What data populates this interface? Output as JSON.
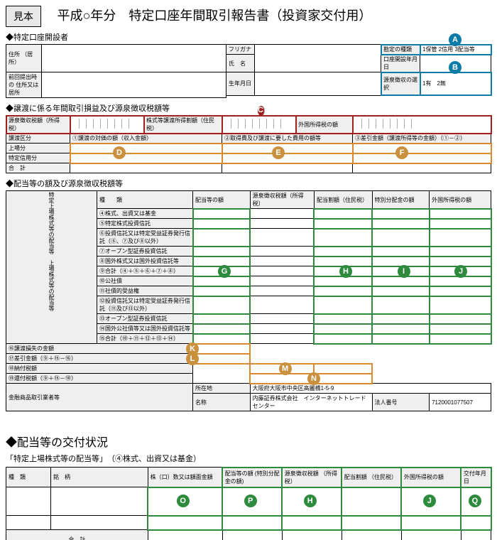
{
  "header": {
    "mihon": "見本",
    "title": "平成○年分　特定口座年間取引報告書（投資家交付用）"
  },
  "section1": {
    "label": "◆特定口座開設者",
    "address_label": "住所\n（居所）",
    "prev_address_label": "前回提出時の\n住所又は居所",
    "furigana": "フリガナ",
    "name_label": "氏　名",
    "birth_label": "生年月日",
    "account_type_label": "勘定の種類",
    "account_type_value": "1保管 2信用 3配当等",
    "open_date_label": "口座開設年月日",
    "withholding_label": "源泉徴収の選択",
    "withholding_value": "1有　2無"
  },
  "section2": {
    "label": "◆譲渡に係る年間取引損益及び源泉徴収税額等",
    "col1": "源泉徴収税額（所得税）",
    "col2": "株式等譲渡所得割額（住民税）",
    "col3": "外国所得税の額",
    "row_label": "譲渡区分",
    "sub1": "①譲渡の対価の額（収入金額）",
    "sub2": "②取得費及び譲渡に要した費用の額等",
    "sub3": "③差引金額（譲渡所得等の金額）（①－②）",
    "row1": "上場分",
    "row2": "特定信用分",
    "row3": "合　計"
  },
  "section3": {
    "label": "◆配当等の額及び源泉徴収税額等",
    "hdr_kind": "種　　類",
    "hdr_c1": "配当等の額",
    "hdr_c2": "源泉徴収税額（所得税）",
    "hdr_c3": "配当割額（住民税）",
    "hdr_c4": "特別分配金の額",
    "hdr_c5": "外国所得税の額",
    "rows": [
      "④株式、出資又は基金",
      "⑤特定株式投資信託",
      "⑥投資信託又は特定受益証券発行信託（⑤、⑦及び⑧以外）",
      "⑦オープン型証券投資信託",
      "⑧国外株式又は国外投資信託等",
      "⑨合計（④＋⑤＋⑥＋⑦＋⑧）",
      "⑩公社債",
      "⑪社債的受益権",
      "⑫投資信託又は特定受益証券発行信託（⑪及び⑬以外）",
      "⑬オープン型証券投資信託",
      "⑭国外公社債等又は国外投資信託等",
      "⑮合計（⑩＋⑪＋⑫＋⑬＋⑭）"
    ],
    "loss": "⑯譲渡損失の金額",
    "diff": "⑰差引金額（⑨＋⑮－⑯）",
    "paid": "⑱納付税額",
    "refund": "⑲還付税額（⑨＋⑮－⑱）",
    "dealer_label": "金融商品取引業者等",
    "dealer_addr_label": "所在地",
    "dealer_addr": "大阪府大阪市中央区高麗橋1-5-9",
    "dealer_name_label": "名称",
    "dealer_name": "内藤証券株式会社　インターネットトレードセンター",
    "corp_no_label": "法人番号",
    "corp_no": "7120001077507"
  },
  "section4": {
    "title": "◆配当等の交付状況",
    "sub": "「特定上場株式等の配当等」　（④株式、出資又は基金）",
    "hdr": {
      "kind": "種　類",
      "name": "銘　柄",
      "qty": "株（口）数又は額面金額",
      "c1": "配当等の額\n(特別分配金の額)",
      "c2": "源泉徴収税額\n（所得税）",
      "c3": "配当割額\n（住民税）",
      "c4": "外国所得税の額",
      "c5": "交付年月日"
    },
    "total": "合　計"
  },
  "callouts": {
    "A": "A",
    "B": "B",
    "C": "C",
    "D": "D",
    "E": "E",
    "F": "F",
    "G": "G",
    "H": "H",
    "I": "I",
    "J": "J",
    "K": "K",
    "L": "L",
    "M": "M",
    "N": "N",
    "O": "O",
    "P": "P",
    "Q": "Q"
  }
}
